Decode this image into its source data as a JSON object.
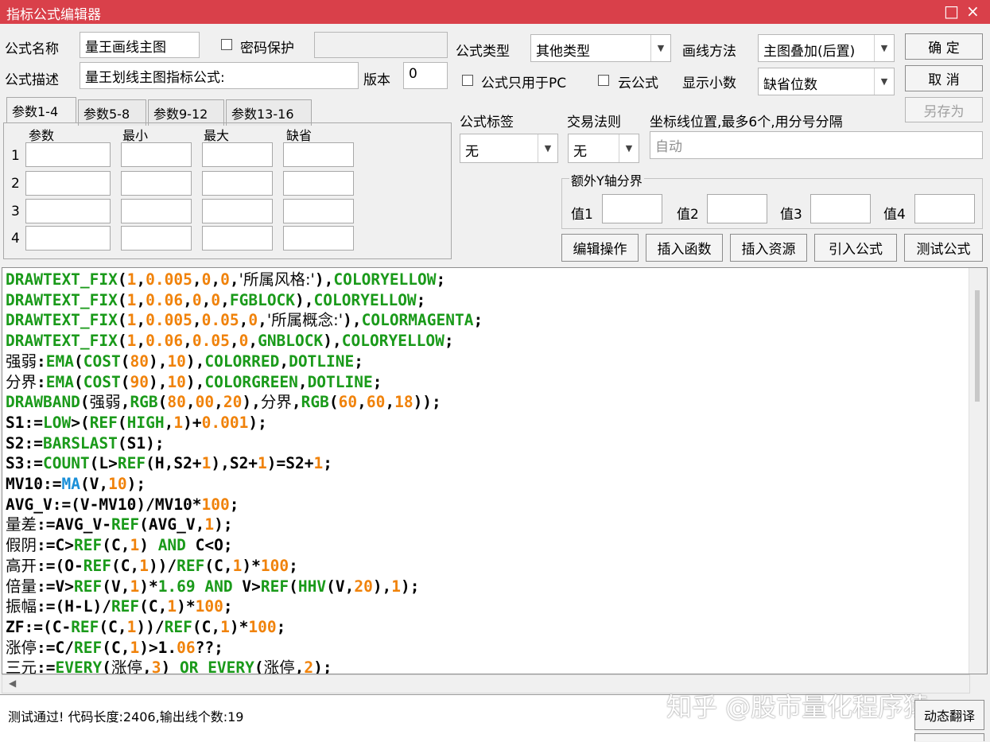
{
  "window": {
    "title": "指标公式编辑器",
    "maximize_glyph": "□",
    "close_glyph": "×"
  },
  "form": {
    "name_label": "公式名称",
    "name_value": "量王画线主图",
    "password_label": "密码保护",
    "desc_label": "公式描述",
    "desc_value": "量王划线主图指标公式:",
    "version_label": "版本",
    "version_value": "0",
    "type_label": "公式类型",
    "type_value": "其他类型",
    "draw_label": "画线方法",
    "draw_value": "主图叠加(后置)",
    "pc_only_label": "公式只用于PC",
    "cloud_label": "云公式",
    "decimals_label": "显示小数",
    "decimals_value": "缺省位数"
  },
  "buttons": {
    "ok": "确  定",
    "cancel": "取  消",
    "save_as": "另存为"
  },
  "tabs": [
    "参数1-4",
    "参数5-8",
    "参数9-12",
    "参数13-16"
  ],
  "params": {
    "headers": [
      "参数",
      "最小",
      "最大",
      "缺省"
    ],
    "rows": [
      "1",
      "2",
      "3",
      "4"
    ]
  },
  "right_panel": {
    "tag_label": "公式标签",
    "tag_value": "无",
    "rule_label": "交易法则",
    "rule_value": "无",
    "coord_label": "坐标线位置,最多6个,用分号分隔",
    "coord_value": "自动",
    "y_group_label": "额外Y轴分界",
    "y_values": [
      "值1",
      "值2",
      "值3",
      "值4"
    ]
  },
  "actions": [
    "编辑操作",
    "插入函数",
    "插入资源",
    "引入公式",
    "测试公式"
  ],
  "status": {
    "message": "测试通过! 代码长度:2406,输出线个数:19",
    "translate_button": "动态翻译"
  },
  "watermark": "知乎 @股市量化程序猿",
  "colors": {
    "titlebar": "#d9404a",
    "keyword": "#1a9a1a",
    "number": "#f0820a",
    "function_ma": "#1a8fd8"
  },
  "icons": {
    "combo_arrow": "chevron-down-icon",
    "scroll_left": "arrow-left-icon"
  }
}
